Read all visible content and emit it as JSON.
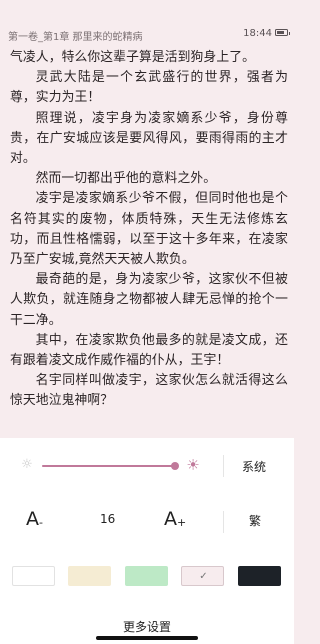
{
  "status": {
    "chapter": "第一卷_第1章 那里来的蛇精病",
    "time": "18:44",
    "battery_level": 0.75
  },
  "content": {
    "paragraphs": [
      {
        "text": "气凌人，特么你这辈子算是活到狗身上了。",
        "indent": false
      },
      {
        "text": "灵武大陆是一个玄武盛行的世界，强者为尊，实力为王！",
        "indent": true
      },
      {
        "text": "照理说，凌宇身为凌家嫡系少爷，身份尊贵，在广安城应该是要风得风，要雨得雨的主才对。",
        "indent": true
      },
      {
        "text": "然而一切都出乎他的意料之外。",
        "indent": true
      },
      {
        "text": "凌宇是凌家嫡系少爷不假，但同时他也是个名符其实的废物，体质特殊，天生无法修炼玄功，而且性格懦弱，以至于这十多年来，在凌家乃至广安城,竟然天天被人欺负。",
        "indent": true
      },
      {
        "text": "最奇葩的是，身为凌家少爷，这家伙不但被人欺负，就连随身之物都被人肆无忌惮的抢个一干二净。",
        "indent": true
      },
      {
        "text": "其中，在凌家欺负他最多的就是凌文成，还有跟着凌文成作威作福的仆从，王宇！",
        "indent": true
      },
      {
        "text": "名宇同样叫做凌宇，这家伙怎么就活得这么惊天地泣鬼神啊？",
        "indent": true
      }
    ]
  },
  "settings": {
    "brightness": {
      "value": 0.99,
      "min_icon": "sun-dim-icon",
      "max_icon": "sun-bright-icon",
      "system_label": "系统",
      "accent": "#c0799a"
    },
    "font": {
      "decrease_label": "A",
      "decrease_sub": "-",
      "size": "16",
      "increase_label": "A",
      "increase_sub": "+",
      "traditional_label": "繁"
    },
    "themes": [
      {
        "name": "white",
        "color": "#ffffff",
        "selected": false
      },
      {
        "name": "cream",
        "color": "#f5ecd3",
        "selected": false
      },
      {
        "name": "green",
        "color": "#bde9c6",
        "selected": false
      },
      {
        "name": "pink",
        "color": "#f7ecee",
        "selected": true
      },
      {
        "name": "dark",
        "color": "#1d2228",
        "selected": false
      }
    ],
    "more_label": "更多设置"
  }
}
